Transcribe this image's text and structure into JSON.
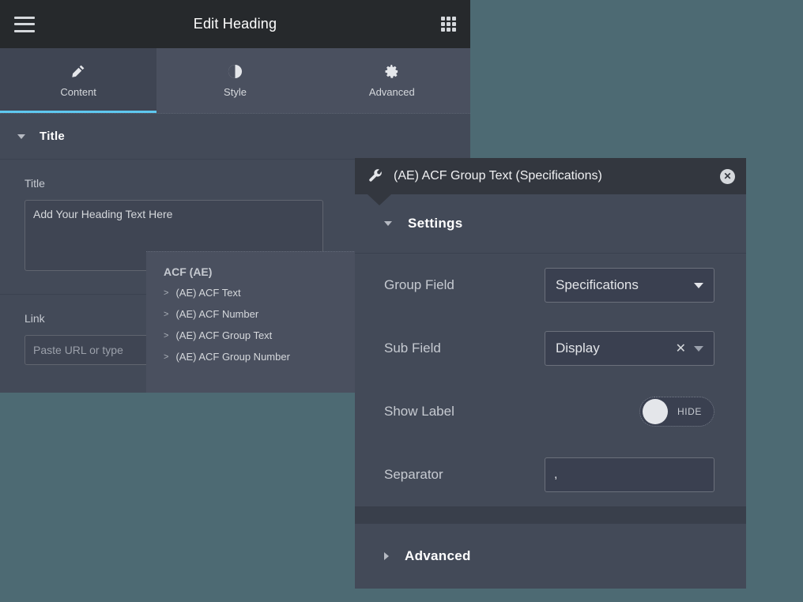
{
  "theme": {
    "canvas_bg": "#4d6a73",
    "panel_bg": "#434a58",
    "header_bg": "#26292c",
    "accent": "#5ec8ef",
    "popup_header_bg": "#33373f"
  },
  "panel": {
    "header": {
      "title": "Edit Heading",
      "menu_icon": "hamburger-icon",
      "apps_icon": "grid-apps-icon"
    },
    "tabs": [
      {
        "label": "Content",
        "icon": "pencil-icon",
        "active": true
      },
      {
        "label": "Style",
        "icon": "contrast-half-circle-icon",
        "active": false
      },
      {
        "label": "Advanced",
        "icon": "gear-icon",
        "active": false
      }
    ],
    "sections": [
      {
        "name": "Title",
        "expanded": true,
        "fields": [
          {
            "label": "Title",
            "type": "textarea",
            "value": "Add Your Heading Text Here",
            "placeholder": ""
          },
          {
            "label": "Link",
            "type": "text",
            "value": "",
            "placeholder": "Paste URL or type"
          }
        ]
      }
    ]
  },
  "acf_menu": {
    "group_title": "ACF (AE)",
    "items": [
      {
        "label": "(AE) ACF Text",
        "marker": ">"
      },
      {
        "label": "(AE) ACF Number",
        "marker": ">"
      },
      {
        "label": "(AE) ACF Group Text",
        "marker": ">"
      },
      {
        "label": "(AE) ACF Group Number",
        "marker": ">"
      }
    ]
  },
  "popup": {
    "title": "(AE) ACF Group Text (Specifications)",
    "wrench_icon": "wrench-icon",
    "close_label": "✕",
    "sections": [
      {
        "name": "Settings",
        "expanded": true,
        "controls": [
          {
            "label": "Group Field",
            "type": "select",
            "value": "Specifications",
            "clearable": false
          },
          {
            "label": "Sub Field",
            "type": "select",
            "value": "Display",
            "clearable": true,
            "clear_label": "✕"
          },
          {
            "label": "Show Label",
            "type": "toggle",
            "state_label": "HIDE",
            "on": false
          },
          {
            "label": "Separator",
            "type": "text",
            "value": ",",
            "placeholder": ""
          }
        ]
      },
      {
        "name": "Advanced",
        "expanded": false,
        "controls": []
      }
    ]
  }
}
